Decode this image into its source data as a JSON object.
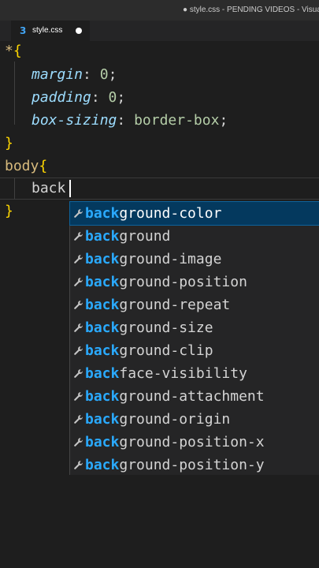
{
  "window": {
    "title": "● style.css - PENDING VIDEOS - Visual St"
  },
  "tab": {
    "label": "style.css",
    "icon": "css-file-icon",
    "dirty": true
  },
  "code": {
    "universal_selector": "*",
    "open_brace": "{",
    "close_brace": "}",
    "declarations": [
      {
        "property": "margin",
        "value": "0"
      },
      {
        "property": "padding",
        "value": "0"
      },
      {
        "property": "box-sizing",
        "value": "border-box"
      }
    ],
    "colon": ": ",
    "semicolon": ";",
    "body_selector": "body",
    "typed_text": "back"
  },
  "suggestions": {
    "match_text": "back",
    "items": [
      {
        "match": "back",
        "rest": "ground-color",
        "selected": true
      },
      {
        "match": "back",
        "rest": "ground",
        "selected": false
      },
      {
        "match": "back",
        "rest": "ground-image",
        "selected": false
      },
      {
        "match": "back",
        "rest": "ground-position",
        "selected": false
      },
      {
        "match": "back",
        "rest": "ground-repeat",
        "selected": false
      },
      {
        "match": "back",
        "rest": "ground-size",
        "selected": false
      },
      {
        "match": "back",
        "rest": "ground-clip",
        "selected": false
      },
      {
        "match": "back",
        "rest": "face-visibility",
        "selected": false
      },
      {
        "match": "back",
        "rest": "ground-attachment",
        "selected": false
      },
      {
        "match": "back",
        "rest": "ground-origin",
        "selected": false
      },
      {
        "match": "back",
        "rest": "ground-position-x",
        "selected": false
      },
      {
        "match": "back",
        "rest": "ground-position-y",
        "selected": false
      }
    ]
  },
  "colors": {
    "editor_bg": "#1e1e1e",
    "match_highlight": "#2aaaff",
    "selected_bg": "#04395e",
    "property": "#9cdcfe",
    "selector": "#d7ba7d",
    "number": "#b5cea8"
  }
}
